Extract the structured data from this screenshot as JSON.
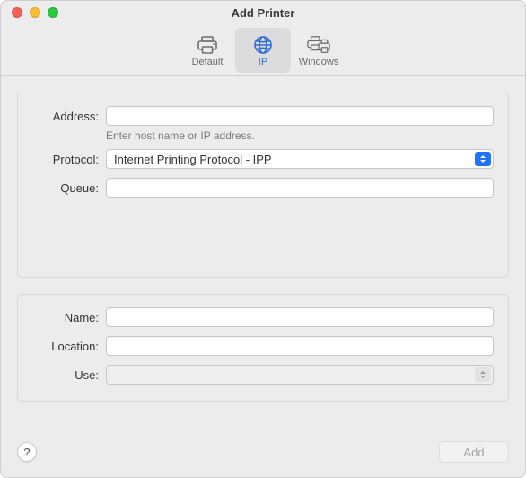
{
  "window": {
    "title": "Add Printer"
  },
  "toolbar": {
    "items": [
      {
        "id": "default",
        "label": "Default",
        "selected": false
      },
      {
        "id": "ip",
        "label": "IP",
        "selected": true
      },
      {
        "id": "windows",
        "label": "Windows",
        "selected": false
      }
    ]
  },
  "fields": {
    "address": {
      "label": "Address:",
      "value": "",
      "hint": "Enter host name or IP address."
    },
    "protocol": {
      "label": "Protocol:",
      "value": "Internet Printing Protocol - IPP"
    },
    "queue": {
      "label": "Queue:",
      "value": ""
    },
    "name": {
      "label": "Name:",
      "value": ""
    },
    "location": {
      "label": "Location:",
      "value": ""
    },
    "use": {
      "label": "Use:",
      "value": ""
    }
  },
  "buttons": {
    "help": "?",
    "add": "Add"
  }
}
